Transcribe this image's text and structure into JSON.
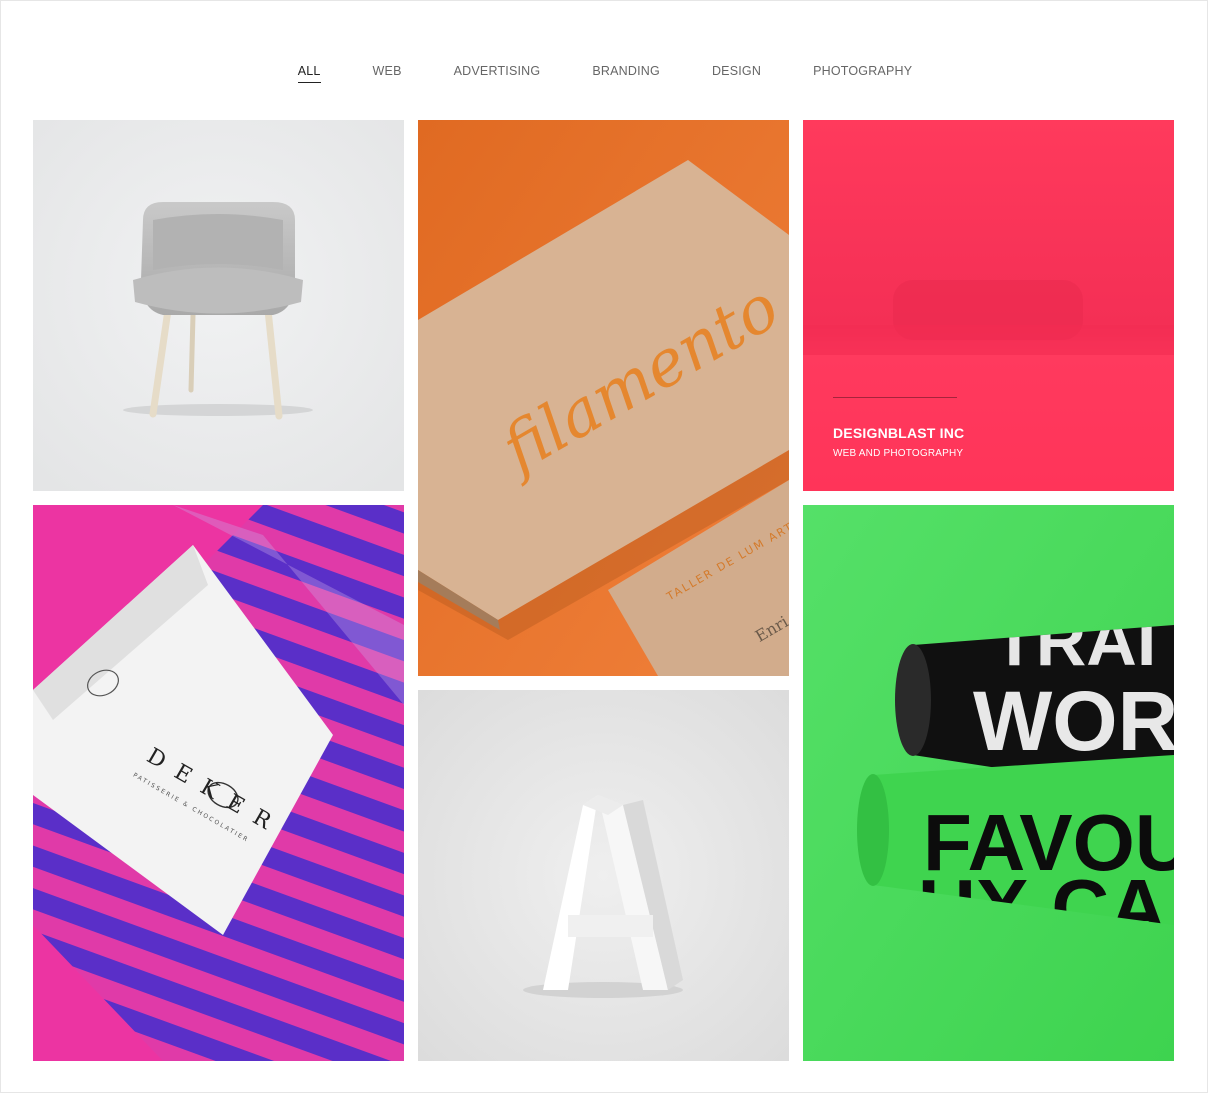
{
  "filters": [
    {
      "label": "ALL",
      "active": true
    },
    {
      "label": "WEB",
      "active": false
    },
    {
      "label": "ADVERTISING",
      "active": false
    },
    {
      "label": "BRANDING",
      "active": false
    },
    {
      "label": "DESIGN",
      "active": false
    },
    {
      "label": "PHOTOGRAPHY",
      "active": false
    }
  ],
  "portfolio": {
    "items": [
      {
        "image": "grey-chair-photo",
        "bg": "#ebeced"
      },
      {
        "image": "filamento-business-card-photo",
        "bg": "#e8732c",
        "card_text": "filamento",
        "side_text": "TALLER DE LUM ARTESANAL",
        "name_text": "Enri"
      },
      {
        "image": "red-blurred-photo",
        "bg": "#fe3458",
        "title": "DESIGNBLAST INC",
        "subtitle": "WEB AND PHOTOGRAPHY"
      },
      {
        "image": "deker-card-on-striped-box-photo",
        "bg": "#e8359f",
        "brand_text": "DEKER",
        "tagline": "PATISSERIE & CHOCOLATIER"
      },
      {
        "image": "white-letter-a-photo",
        "bg": "#e6e6e6",
        "letter": "A"
      },
      {
        "image": "green-posters-photo",
        "bg": "#4cdb5c",
        "lines": [
          "TRAI",
          "WORD",
          "FAVOU",
          "UX CA"
        ]
      }
    ]
  }
}
